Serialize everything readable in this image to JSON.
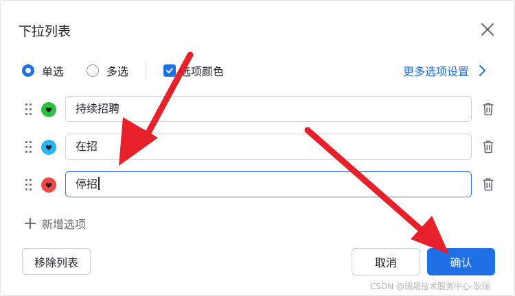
{
  "dialog": {
    "title": "下拉列表"
  },
  "options_bar": {
    "single_label": "单选",
    "multi_label": "多选",
    "color_label": "选项颜色",
    "more_label": "更多选项设置",
    "selected_mode": "single",
    "color_enabled": true
  },
  "items": [
    {
      "value": "持续招聘",
      "color": "#2fbf41",
      "focused": false
    },
    {
      "value": "在招",
      "color": "#29b6f6",
      "focused": false
    },
    {
      "value": "停招",
      "color": "#f04848",
      "focused": true
    }
  ],
  "add_option_label": "新增选项",
  "buttons": {
    "remove": "移除列表",
    "cancel": "取消",
    "confirm": "确认"
  },
  "watermark": "CSDN @瑞晟技术服务中心-耿瑞",
  "colors": {
    "accent": "#1f6fe5",
    "annotation_arrow": "#e8202a"
  },
  "icons": [
    "close-icon",
    "chevron-right-icon",
    "drag-handle-icon",
    "heart-icon",
    "trash-icon",
    "plus-icon",
    "check-icon"
  ]
}
